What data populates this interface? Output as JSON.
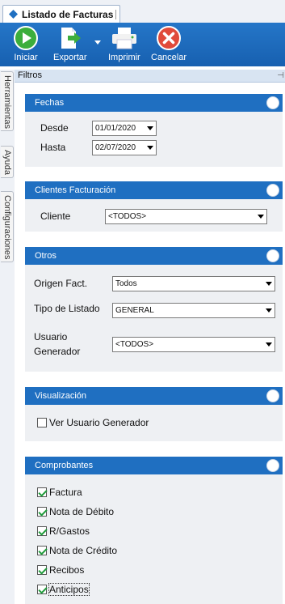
{
  "tab": {
    "title": "Listado de Facturas"
  },
  "toolbar": {
    "iniciar": "Iniciar",
    "exportar": "Exportar",
    "imprimir": "Imprimir",
    "cancelar": "Cancelar"
  },
  "filtros": {
    "title": "Filtros"
  },
  "sidebar": {
    "herramientas": "Herramientas",
    "ayuda": "Ayuda",
    "configuraciones": "Configuraciones"
  },
  "fechas": {
    "title": "Fechas",
    "desde_label": "Desde",
    "desde_value": "01/01/2020",
    "hasta_label": "Hasta",
    "hasta_value": "02/07/2020"
  },
  "clientes": {
    "title": "Clientes Facturación",
    "cliente_label": "Cliente",
    "cliente_value": "<TODOS>"
  },
  "otros": {
    "title": "Otros",
    "origen_label": "Origen Fact.",
    "origen_value": "Todos",
    "tipo_label": "Tipo de Listado",
    "tipo_value": "GENERAL",
    "usuario_label_1": "Usuario",
    "usuario_label_2": "Generador",
    "usuario_value": "<TODOS>"
  },
  "visualizacion": {
    "title": "Visualización",
    "ver_usuario": "Ver Usuario Generador",
    "ver_usuario_checked": false
  },
  "comprobantes": {
    "title": "Comprobantes",
    "items": [
      "Factura",
      "Nota de Débito",
      "R/Gastos",
      "Nota de Crédito",
      "Recibos",
      "Anticipos"
    ]
  },
  "colors": {
    "toolbar": "#1f6fc1",
    "group_header": "#1f6fc1",
    "check": "#1f9a3a"
  }
}
